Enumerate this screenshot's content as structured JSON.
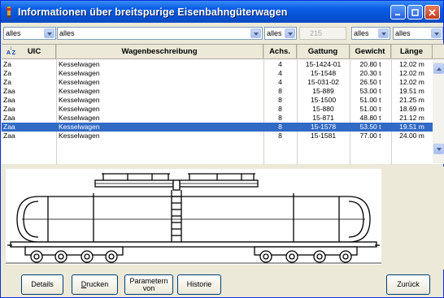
{
  "window": {
    "title": "Informationen über breitspurige Eisenbahngüterwagen"
  },
  "filters": {
    "uic": "alles",
    "beschreibung": "alles",
    "achsen": "alles",
    "count": "215",
    "gewicht": "alles",
    "laenge": "alles"
  },
  "table": {
    "headers": {
      "uic": "UIC",
      "beschreibung": "Wagenbeschreibung",
      "achsen": "Achs.",
      "gattung": "Gattung",
      "gewicht": "Gewicht",
      "laenge": "Länge"
    },
    "sort_icon": "sort-ascending-icon",
    "rows": [
      {
        "uic": "Za",
        "beschreibung": "Kesselwagen",
        "achsen": "4",
        "gattung": "15-1424-01",
        "gewicht": "20.80 t",
        "laenge": "12.02 m"
      },
      {
        "uic": "Za",
        "beschreibung": "Kesselwagen",
        "achsen": "4",
        "gattung": "15-1548",
        "gewicht": "20.30 t",
        "laenge": "12.02 m"
      },
      {
        "uic": "Za",
        "beschreibung": "Kesselwagen",
        "achsen": "4",
        "gattung": "15-031-02",
        "gewicht": "26.50 t",
        "laenge": "12.02 m"
      },
      {
        "uic": "Zaa",
        "beschreibung": "Kesselwagen",
        "achsen": "8",
        "gattung": "15-889",
        "gewicht": "53.00 t",
        "laenge": "19.51 m"
      },
      {
        "uic": "Zaa",
        "beschreibung": "Kesselwagen",
        "achsen": "8",
        "gattung": "15-1500",
        "gewicht": "51.00 t",
        "laenge": "21.25 m"
      },
      {
        "uic": "Zaa",
        "beschreibung": "Kesselwagen",
        "achsen": "8",
        "gattung": "15-880",
        "gewicht": "51.00 t",
        "laenge": "18.69 m"
      },
      {
        "uic": "Zaa",
        "beschreibung": "Kesselwagen",
        "achsen": "8",
        "gattung": "15-871",
        "gewicht": "48.80 t",
        "laenge": "21.12 m"
      },
      {
        "uic": "Zaa",
        "beschreibung": "Kesselwagen",
        "achsen": "8",
        "gattung": "15-1578",
        "gewicht": "53.50 t",
        "laenge": "19.51 m",
        "selected": true
      },
      {
        "uic": "Zaa",
        "beschreibung": "Kesselwagen",
        "achsen": "8",
        "gattung": "15-1581",
        "gewicht": "77.00 t",
        "laenge": "24.00 m"
      }
    ]
  },
  "buttons": {
    "details": "Details",
    "drucken_u": "D",
    "drucken_rest": "rucken",
    "parameter_line1": "Parametern",
    "parameter_line2": "von",
    "historie": "Historie",
    "zurueck": "Zurück"
  },
  "colors": {
    "selection": "#316ac5",
    "titlebar": "#0552d2"
  }
}
